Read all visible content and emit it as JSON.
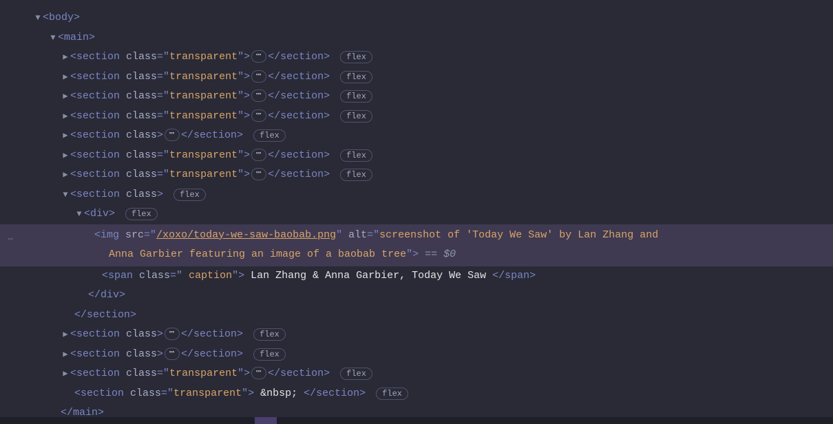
{
  "badges": {
    "flex": "flex"
  },
  "sel_marker": "== $0",
  "nbsp": " ",
  "nodes": {
    "body": {
      "open": "<body>"
    },
    "main": {
      "open": "<main>",
      "close": "</main>"
    },
    "section_transparent": {
      "open_pre": "<section ",
      "attr": "class",
      "eq": "=",
      "q": "\"",
      "val": "transparent",
      "close_open": ">",
      "close": "</section>"
    },
    "section_class": {
      "open_pre": "<section ",
      "attr": "class",
      "close_open": ">",
      "close": "</section>"
    },
    "div": {
      "open": "<div>",
      "close": "</div>"
    },
    "img": {
      "open": "<img ",
      "src_attr": "src",
      "src_val": "/xoxo/today-we-saw-baobab.png",
      "alt_attr": "alt",
      "alt_val_a": "screenshot of 'Today We Saw' by Lan Zhang and",
      "alt_val_b": "Anna Garbier featuring an image of a baobab tree",
      "end": ">"
    },
    "span": {
      "open_pre": "<span ",
      "attr": "class",
      "eq": "=",
      "q": "\"",
      "val": " caption",
      "close_open": ">",
      "text": " Lan Zhang & Anna Garbier, Today We Saw ",
      "close": "</span>"
    }
  }
}
